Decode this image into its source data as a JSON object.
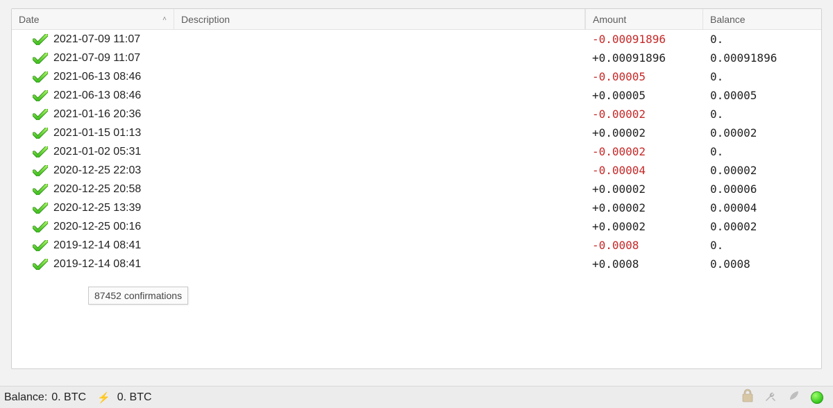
{
  "columns": {
    "date": "Date",
    "description": "Description",
    "amount": "Amount",
    "balance": "Balance"
  },
  "sort": {
    "column": "date",
    "direction_glyph": "˄"
  },
  "transactions": [
    {
      "date": "2021-07-09 11:07",
      "description": "",
      "amount": "-0.00091896",
      "amount_sign": "neg",
      "balance": "0."
    },
    {
      "date": "2021-07-09 11:07",
      "description": "",
      "amount": "+0.00091896",
      "amount_sign": "pos",
      "balance": "0.00091896"
    },
    {
      "date": "2021-06-13 08:46",
      "description": "",
      "amount": "-0.00005",
      "amount_sign": "neg",
      "balance": "0."
    },
    {
      "date": "2021-06-13 08:46",
      "description": "",
      "amount": "+0.00005",
      "amount_sign": "pos",
      "balance": "0.00005"
    },
    {
      "date": "2021-01-16 20:36",
      "description": "",
      "amount": "-0.00002",
      "amount_sign": "neg",
      "balance": "0."
    },
    {
      "date": "2021-01-15 01:13",
      "description": "",
      "amount": "+0.00002",
      "amount_sign": "pos",
      "balance": "0.00002"
    },
    {
      "date": "2021-01-02 05:31",
      "description": "",
      "amount": "-0.00002",
      "amount_sign": "neg",
      "balance": "0."
    },
    {
      "date": "2020-12-25 22:03",
      "description": "",
      "amount": "-0.00004",
      "amount_sign": "neg",
      "balance": "0.00002"
    },
    {
      "date": "2020-12-25 20:58",
      "description": "",
      "amount": "+0.00002",
      "amount_sign": "pos",
      "balance": "0.00006"
    },
    {
      "date": "2020-12-25 13:39",
      "description": "",
      "amount": "+0.00002",
      "amount_sign": "pos",
      "balance": "0.00004"
    },
    {
      "date": "2020-12-25 00:16",
      "description": "",
      "amount": "+0.00002",
      "amount_sign": "pos",
      "balance": "0.00002"
    },
    {
      "date": "2019-12-14 08:41",
      "description": "",
      "amount": "-0.0008",
      "amount_sign": "neg",
      "balance": "0."
    },
    {
      "date": "2019-12-14 08:41",
      "description": "",
      "amount": "+0.0008",
      "amount_sign": "pos",
      "balance": "0.0008"
    }
  ],
  "tooltip": "87452 confirmations",
  "statusbar": {
    "balance_label": "Balance:",
    "balance_value": "0. BTC",
    "lightning_value": "0. BTC"
  },
  "icons": {
    "confirmed": "confirmed-check-icon",
    "lock": "lock-icon",
    "tools": "tools-icon",
    "seed": "seed-icon",
    "network": "network-status-icon"
  }
}
